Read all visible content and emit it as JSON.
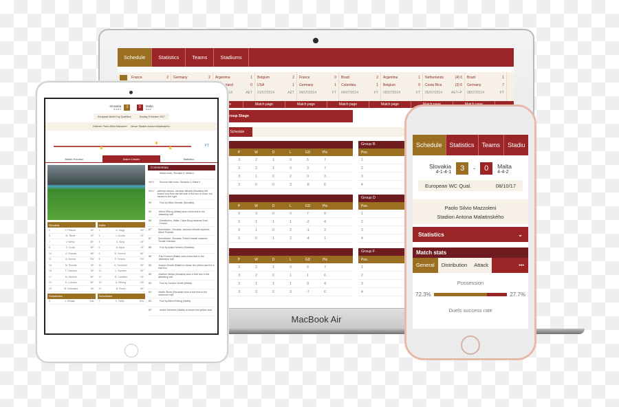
{
  "laptop": {
    "brand": "MacBook Air",
    "tabs": [
      "Schedule",
      "Statistics",
      "Teams",
      "Stadiums"
    ],
    "fixtures": [
      {
        "home": "France",
        "hs": "2",
        "away": "Germany",
        "as": "",
        "date": "",
        "res": ""
      },
      {
        "home": "Germany",
        "hs": "2",
        "away": "",
        "as": "",
        "date": "",
        "res": ""
      },
      {
        "home": "Argentina",
        "hs": "1",
        "away": "Switzerland",
        "as": "0",
        "date": "01/07/2014",
        "res": "AET"
      },
      {
        "home": "Belgium",
        "hs": "2",
        "away": "USA",
        "as": "1",
        "date": "01/07/2014",
        "res": "AET"
      },
      {
        "home": "France",
        "hs": "0",
        "away": "Germany",
        "as": "1",
        "date": "04/07/2014",
        "res": "FT"
      },
      {
        "home": "Brazil",
        "hs": "2",
        "away": "Colombia",
        "as": "1",
        "date": "04/07/2014",
        "res": "FT"
      },
      {
        "home": "Argentina",
        "hs": "1",
        "away": "Belgium",
        "as": "0",
        "date": "05/07/2014",
        "res": "FT"
      },
      {
        "home": "Netherlands",
        "hs": "(4) 0",
        "away": "Costa Rica",
        "as": "(3) 0",
        "date": "05/07/2014",
        "res": "AET+P"
      },
      {
        "home": "Brazil",
        "hs": "1",
        "away": "Germany",
        "as": "7",
        "date": "08/07/2014",
        "res": "FT"
      }
    ],
    "match_page": "Match page",
    "group_stage": "Group Stage",
    "full_schedule": "Full Schedule",
    "stand_cols": [
      "P",
      "W",
      "D",
      "L",
      "GD",
      "Pts"
    ],
    "pos_label": "Pos.",
    "groups": [
      {
        "name": "Group B",
        "rows": [
          [
            "3",
            "2",
            "1",
            "0",
            "5",
            "7"
          ],
          [
            "3",
            "2",
            "1",
            "0",
            "3",
            "7"
          ],
          [
            "3",
            "1",
            "0",
            "2",
            "0",
            "3"
          ],
          [
            "3",
            "0",
            "0",
            "3",
            "-8",
            "0"
          ]
        ]
      },
      {
        "name": "Group D",
        "rows": [
          [
            "3",
            "3",
            "0",
            "0",
            "7",
            "9"
          ],
          [
            "3",
            "1",
            "1",
            "1",
            "-2",
            "4"
          ],
          [
            "3",
            "1",
            "0",
            "2",
            "-1",
            "3"
          ],
          [
            "3",
            "0",
            "1",
            "2",
            "-4",
            "1"
          ]
        ]
      },
      {
        "name": "Group F",
        "rows": [
          [
            "3",
            "2",
            "1",
            "0",
            "6",
            "7"
          ],
          [
            "3",
            "2",
            "0",
            "1",
            "1",
            "6"
          ],
          [
            "3",
            "1",
            "1",
            "1",
            "0",
            "4"
          ],
          [
            "3",
            "0",
            "0",
            "3",
            "-7",
            "0"
          ]
        ]
      }
    ]
  },
  "tablet": {
    "home": "Slovakia",
    "home_form": "4-1-4-1",
    "home_score": "3",
    "away": "Malta",
    "away_form": "4-4-2",
    "away_score": "0",
    "competition": "European World Cup Qualifiers",
    "date": "Sunday 8 October 2017",
    "referee": "Referee: Paolo Silvio Mazzoleni",
    "venue": "Venue: Stadion Antona Malatinského",
    "ft": "FT",
    "tabs": [
      "Match Preview",
      "Match Details",
      "Statistics"
    ],
    "commentary_title": "Commentary",
    "commentary": [
      {
        "t": "",
        "x": "Match ends, Slovakia 3, Malta 0."
      },
      {
        "t": "90+2'",
        "x": "Second Half ends, Slovakia 3, Malta 0."
      },
      {
        "t": "90+1'",
        "x": "Attempt missed. Jaroslav Mihalik (Slovakia) left footed shot from the left side of the box is close, but misses to the right."
      },
      {
        "t": "90'",
        "x": "Foul by Milan Skriniar (Slovakia)."
      },
      {
        "t": "90'",
        "x": "Alfred Effiong (Malta) wins a free kick in the attacking half."
      },
      {
        "t": "88'",
        "x": "Substitution, Malta. Clyde Borg replaces Paul Fenech."
      },
      {
        "t": "87'",
        "x": "Substitution, Slovakia. Jaroslav Mihalik replaces Albert Rusnák."
      },
      {
        "t": "87'",
        "x": "Substitution, Slovakia. Robert Mazáň replaces Tomáš Hubočan."
      },
      {
        "t": "86'",
        "x": "Foul by Adam Nemec (Slovakia)."
      },
      {
        "t": "86'",
        "x": "Paul Fenech (Malta) wins a free kick in the defensive half."
      },
      {
        "t": "83'",
        "x": "Joseph Zerafa (Malta) is shown the yellow card for a bad foul."
      },
      {
        "t": "83'",
        "x": "Vladimír Weiss (Slovakia) wins a free kick in the attacking half."
      },
      {
        "t": "83'",
        "x": "Foul by Joseph Zerafa (Malta)."
      },
      {
        "t": "83'",
        "x": "Martin Škrtel (Slovakia) wins a free kick in the defensive half."
      },
      {
        "t": "83'",
        "x": "Foul by Alfred Effiong (Malta)."
      },
      {
        "t": "82'",
        "x": "André Schembri (Malta) is shown the yellow card."
      }
    ],
    "lineup_home": [
      [
        "2",
        "P. Pekarík",
        "DF"
      ],
      [
        "3",
        "M. Škrtel",
        "DF"
      ],
      [
        "7",
        "V. Weiss",
        "MF"
      ],
      [
        "8",
        "O. Duda",
        "MF"
      ],
      [
        "10",
        "A. Rusnák",
        "MF"
      ],
      [
        "11",
        "A. Nemec",
        "FW"
      ],
      [
        "14",
        "M. Škriniar",
        "DF"
      ],
      [
        "15",
        "T. Hubočan",
        "DF"
      ],
      [
        "17",
        "M. Hamšík",
        "MF"
      ],
      [
        "22",
        "S. Lobotka",
        "MF"
      ],
      [
        "23",
        "M. Dúbravka",
        "GK"
      ]
    ],
    "lineup_away": [
      [
        "1",
        "A. Hogg",
        "GK"
      ],
      [
        "3",
        "J. Zerafa",
        "DF"
      ],
      [
        "4",
        "S. Borg",
        "DF"
      ],
      [
        "5",
        "A. Agius",
        "DF"
      ],
      [
        "6",
        "R. Fenech",
        "MF"
      ],
      [
        "8",
        "P. Fenech",
        "FW"
      ],
      [
        "10",
        "A. Schembri",
        "MF"
      ],
      [
        "11",
        "L. Gambin",
        "MF"
      ],
      [
        "17",
        "R. Camilleri",
        "DF"
      ],
      [
        "19",
        "A. Effiong",
        "FW"
      ],
      [
        "21",
        "B. Pisani",
        "MF"
      ]
    ],
    "subs_label": "Substitutes",
    "sub_home": [
      "9",
      "J. Mihalik",
      "Sub"
    ],
    "sub_away": [
      "7",
      "C. Failla",
      "Sub"
    ]
  },
  "phone": {
    "tabs": [
      "Schedule",
      "Statistics",
      "Teams",
      "Stadiu"
    ],
    "home": "Slovakia",
    "home_form": "4-1-4-1",
    "home_score": "3",
    "sep": "-",
    "away": "Malta",
    "away_form": "4-4-2",
    "away_score": "0",
    "competition": "European WC Qual.",
    "date": "08/10/17",
    "referee": "Paolo Silvio Mazzoleni",
    "venue": "Stadion Antona Malatinského",
    "statistics": "Statistics",
    "match_stats": "Match stats",
    "stat_tabs": [
      "General",
      "Distribution",
      "Attack",
      "•••"
    ],
    "possession_label": "Possession",
    "possession_home": "72.3%",
    "possession_away": "27.7%",
    "possession_home_frac": 0.723,
    "duels_label": "Duels success rate"
  },
  "colors": {
    "red": "#9b2426",
    "gold": "#9a6f21",
    "dark_red": "#6e1c1f",
    "cream": "#f6f0e6"
  }
}
